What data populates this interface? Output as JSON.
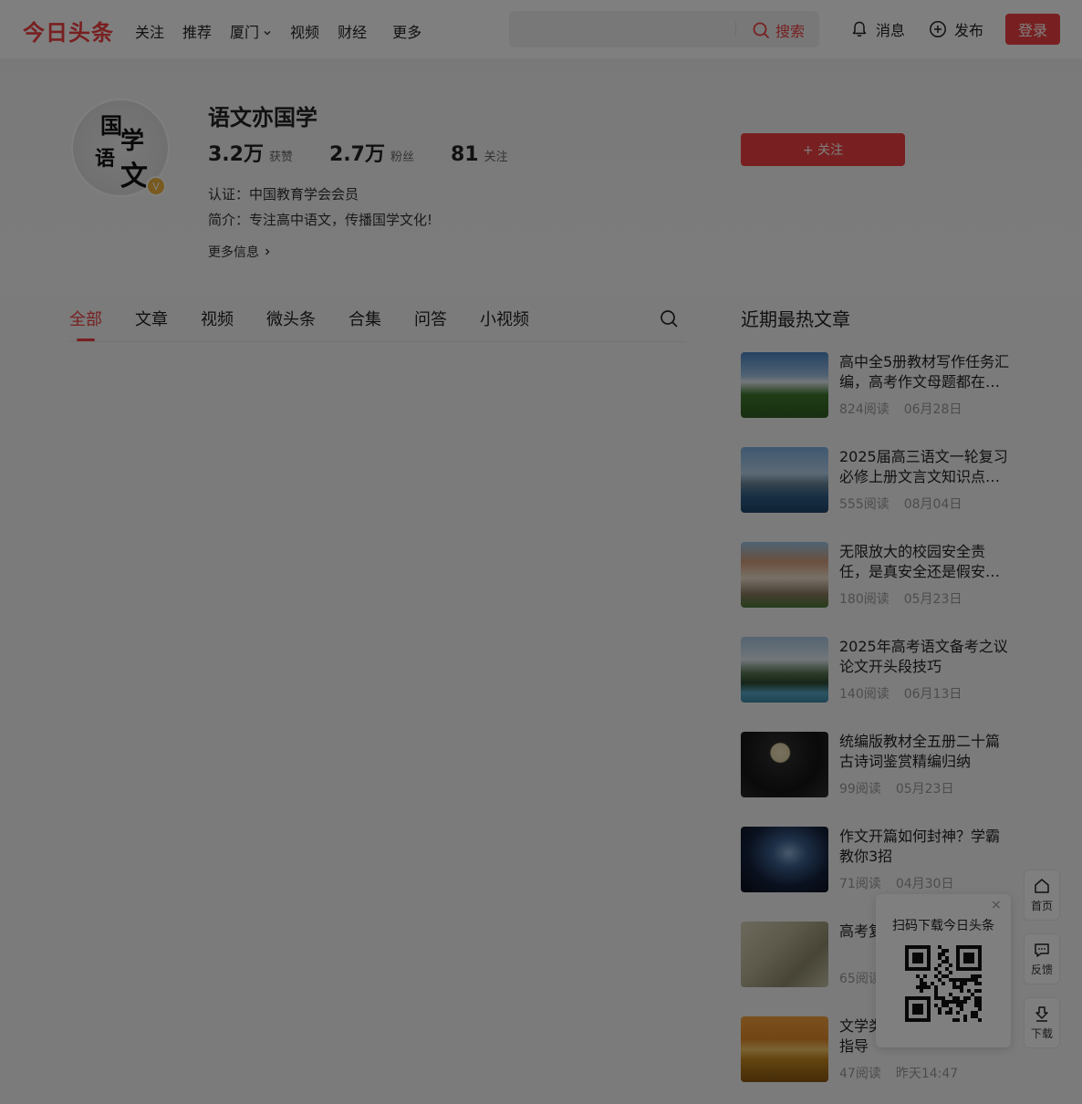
{
  "header": {
    "logo": "今日头条",
    "nav": [
      "关注",
      "推荐",
      "厦门",
      "视频",
      "财经"
    ],
    "nav_more": "更多",
    "search_placeholder": "",
    "search_label": "搜索",
    "messages_label": "消息",
    "publish_label": "发布",
    "login_label": "登录"
  },
  "profile": {
    "name": "语文亦国学",
    "avatar_text": [
      "国",
      "学",
      "语",
      "文"
    ],
    "stats": [
      {
        "num": "3.2万",
        "label": "获赞"
      },
      {
        "num": "2.7万",
        "label": "粉丝"
      },
      {
        "num": "81",
        "label": "关注"
      }
    ],
    "certification": "认证：中国教育学会会员",
    "intro": "简介：专注高中语文，传播国学文化!",
    "more_info": "更多信息",
    "follow_label": "+ 关注"
  },
  "tabs": [
    "全部",
    "文章",
    "视频",
    "微头条",
    "合集",
    "问答",
    "小视频"
  ],
  "hot": {
    "title": "近期最热文章",
    "articles": [
      {
        "title": "高中全5册教材写作任务汇编，高考作文母题都在…",
        "reads": "824阅读",
        "date": "06月28日"
      },
      {
        "title": "2025届高三语文一轮复习必修上册文言文知识点…",
        "reads": "555阅读",
        "date": "08月04日"
      },
      {
        "title": "无限放大的校园安全责任，是真安全还是假安…",
        "reads": "180阅读",
        "date": "05月23日"
      },
      {
        "title": "2025年高考语文备考之议论文开头段技巧",
        "reads": "140阅读",
        "date": "06月13日"
      },
      {
        "title": "统编版教材全五册二十篇古诗词鉴赏精编归纳",
        "reads": "99阅读",
        "date": "05月23日"
      },
      {
        "title": "作文开篇如何封神？学霸教你3招",
        "reads": "71阅读",
        "date": "04月30日"
      },
      {
        "title": "高考复习鉴赏之",
        "reads": "65阅读",
        "date": ""
      },
      {
        "title": "文学类评类\"试题规范解答指导",
        "reads": "47阅读",
        "date": "昨天14:47"
      }
    ]
  },
  "side": {
    "home": "首页",
    "feedback": "反馈",
    "download": "下载"
  },
  "qr": {
    "title": "扫码下载今日头条",
    "close": "×"
  }
}
